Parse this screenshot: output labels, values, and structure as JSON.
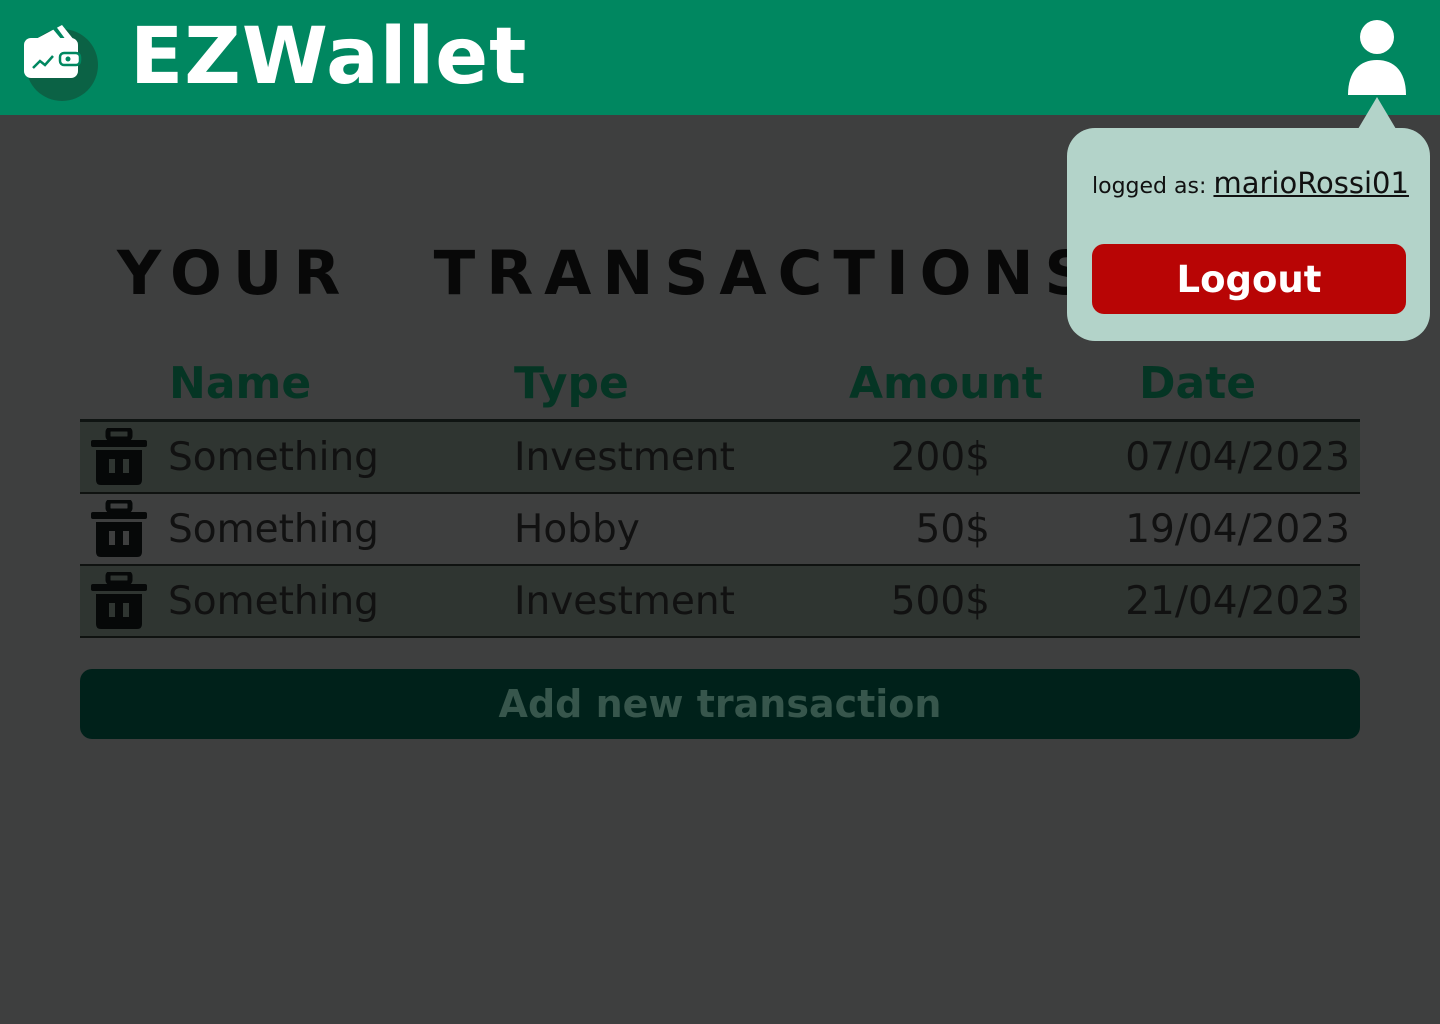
{
  "app": {
    "title": "EZWallet"
  },
  "user_menu": {
    "logged_as_label": "logged as:",
    "username": "marioRossi01",
    "logout_label": "Logout"
  },
  "page": {
    "title": "YOUR TRANSACTIONS"
  },
  "table": {
    "columns": [
      "Name",
      "Type",
      "Amount",
      "Date"
    ],
    "rows": [
      {
        "name": "Something",
        "type": "Investment",
        "amount": "200$",
        "date": "07/04/2023"
      },
      {
        "name": "Something",
        "type": "Hobby",
        "amount": "50$",
        "date": "19/04/2023"
      },
      {
        "name": "Something",
        "type": "Investment",
        "amount": "500$",
        "date": "21/04/2023"
      }
    ]
  },
  "actions": {
    "add_label": "Add new transaction"
  },
  "icons": {
    "logo": "wallet-logo-icon",
    "user": "user-icon",
    "delete": "trash-icon"
  },
  "colors": {
    "brand": "#008760",
    "logout": "#b80505",
    "popover": "#b3d3c9",
    "overlay": "#3e3f3f"
  }
}
